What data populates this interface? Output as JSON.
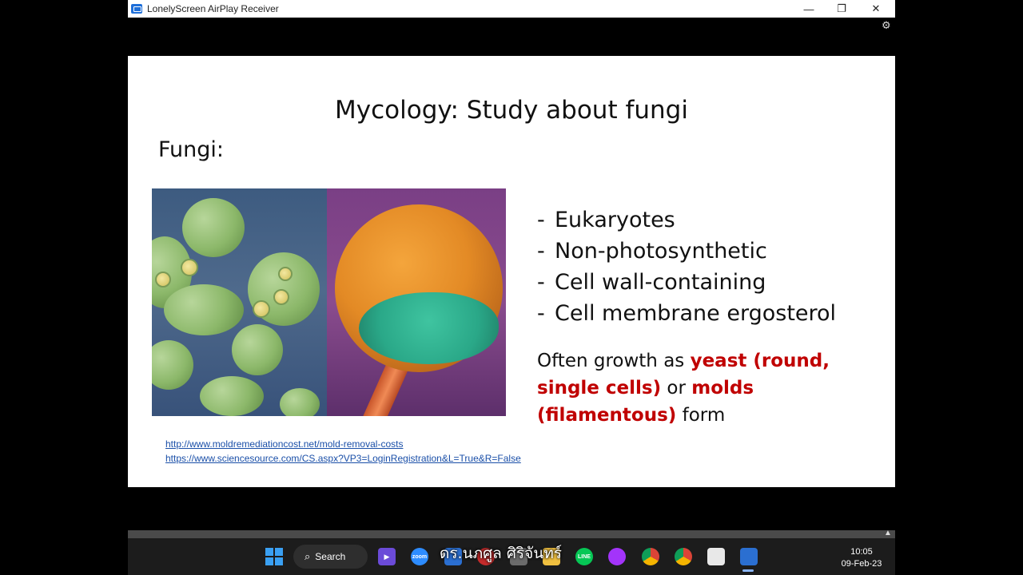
{
  "window": {
    "title": "LonelyScreen AirPlay Receiver",
    "controls": {
      "minimize": "—",
      "restore": "❐",
      "close": "✕"
    }
  },
  "slide": {
    "title": "Mycology: Study about fungi",
    "subtitle": "Fungi:",
    "bullets": [
      "Eukaryotes",
      "Non-photosynthetic",
      "Cell wall-containing",
      "Cell membrane ergosterol"
    ],
    "bullet_dash": "-",
    "growth": {
      "p1": "Often growth as ",
      "yeast": "yeast (round, single cells)",
      "p2": " or ",
      "molds": "molds (filamentous)",
      "p3": " form"
    },
    "links": [
      "http://www.moldremediationcost.net/mold-removal-costs",
      "https://www.sciencesource.com/CS.aspx?VP3=LoginRegistration&L=True&R=False"
    ],
    "accent_color": "#c00000"
  },
  "taskbar": {
    "search_label": "Search",
    "caption": "ดร.นภศูล ศิริจันทร์",
    "time": "10:05",
    "date": "09-Feb-23",
    "icons": [
      "windows-start-icon",
      "search-icon",
      "meet-icon",
      "zoom-icon",
      "file-explorer-icon",
      "line-icon",
      "messenger-icon",
      "chrome-icon",
      "chrome-profile-icon",
      "snipping-tool-icon",
      "lonelyscreen-icon"
    ]
  }
}
